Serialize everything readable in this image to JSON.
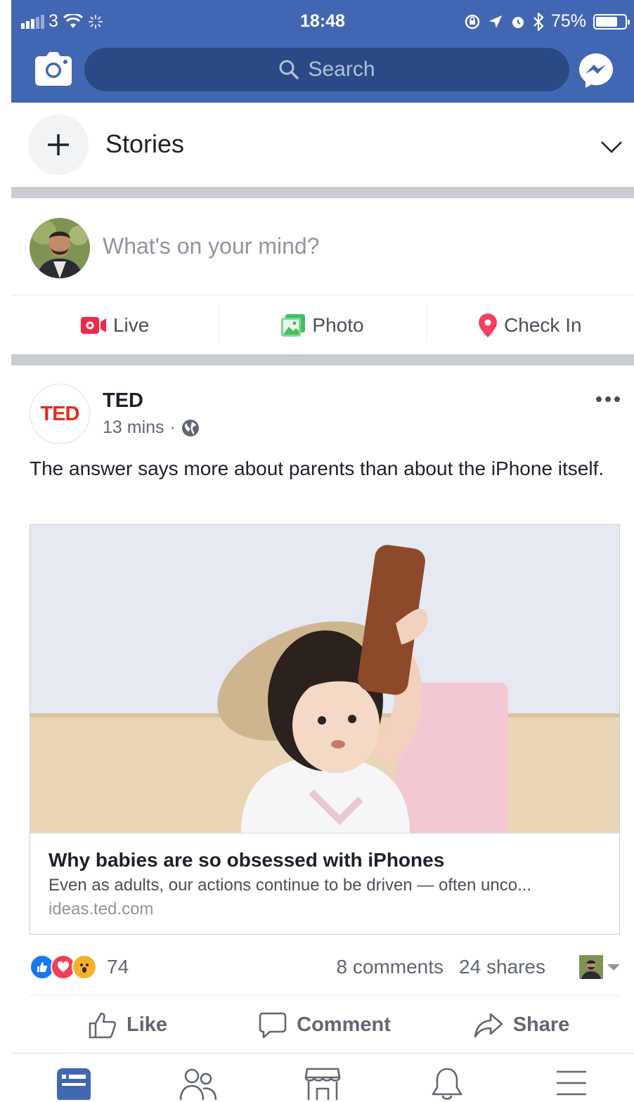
{
  "status_bar": {
    "carrier": "3",
    "time": "18:48",
    "battery": "75%",
    "battery_level": 0.75
  },
  "header": {
    "search_placeholder": "Search",
    "icons": [
      "camera-icon",
      "search-icon",
      "messenger-icon"
    ]
  },
  "stories": {
    "label": "Stories"
  },
  "composer": {
    "placeholder": "What's on your mind?",
    "actions": [
      {
        "label": "Live",
        "icon": "live-video-icon",
        "color": "#f02849"
      },
      {
        "label": "Photo",
        "icon": "photo-icon",
        "color": "#45bd62"
      },
      {
        "label": "Check In",
        "icon": "location-pin-icon",
        "color": "#f3425f"
      }
    ]
  },
  "post": {
    "page_logo": "TED",
    "page_name": "TED",
    "time": "13 mins",
    "separator": "·",
    "text": "The answer says more about parents than about the iPhone itself.",
    "link": {
      "title": "Why babies are so obsessed with iPhones",
      "description": "Even as adults, our actions continue to be driven — often unco...",
      "domain": "ideas.ted.com"
    },
    "reactions": {
      "types": [
        "like",
        "love",
        "wow"
      ],
      "count": "74",
      "comments": "8 comments",
      "shares": "24 shares"
    },
    "actions": [
      {
        "label": "Like",
        "icon": "thumbs-up-icon"
      },
      {
        "label": "Comment",
        "icon": "comment-icon"
      },
      {
        "label": "Share",
        "icon": "share-icon"
      }
    ]
  },
  "tabbar": {
    "tabs": [
      "news-feed-icon",
      "friends-icon",
      "marketplace-icon",
      "notifications-icon",
      "menu-icon"
    ],
    "active_tab": "news-feed-icon"
  },
  "colors": {
    "brand_blue": "#4267b2",
    "search_bg": "#2b4a85",
    "ted_red": "#e62b1e",
    "like_blue": "#1877f2",
    "love_red": "#f33e58",
    "wow_yellow": "#f7b125"
  }
}
